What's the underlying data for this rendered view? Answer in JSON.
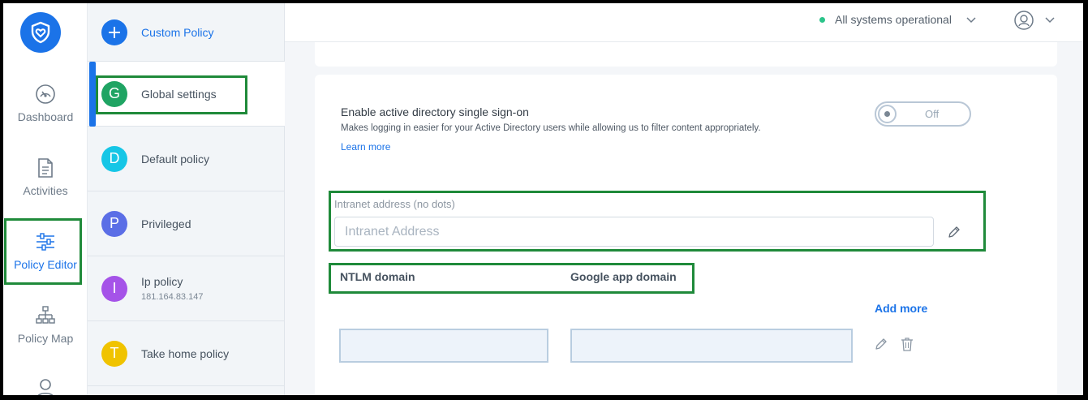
{
  "nav": {
    "items": [
      {
        "label": "Dashboard",
        "icon": "gauge-icon"
      },
      {
        "label": "Activities",
        "icon": "document-icon"
      },
      {
        "label": "Policy Editor",
        "icon": "sliders-icon"
      },
      {
        "label": "Policy Map",
        "icon": "hierarchy-icon"
      }
    ]
  },
  "policies": {
    "custom": {
      "label": "Custom Policy"
    },
    "items": [
      {
        "letter": "G",
        "name": "Global settings",
        "color": "#1fa463"
      },
      {
        "letter": "D",
        "name": "Default policy",
        "color": "#16c6e6"
      },
      {
        "letter": "P",
        "name": "Privileged",
        "color": "#5b6ee6"
      },
      {
        "letter": "I",
        "name": "Ip policy",
        "sub": "181.164.83.147",
        "color": "#a553e8"
      },
      {
        "letter": "T",
        "name": "Take home policy",
        "color": "#f0c300"
      }
    ]
  },
  "topbar": {
    "status": "All systems operational",
    "status_color": "#2bc48a"
  },
  "settings": {
    "sso_title": "Enable active directory single sign-on",
    "sso_desc": "Makes logging in easier for your Active Directory users while allowing us to filter content appropriately.",
    "learn_more": "Learn more",
    "toggle_state": "Off",
    "intranet_label": "Intranet address (no dots)",
    "intranet_placeholder": "Intranet Address",
    "ntlm_header": "NTLM domain",
    "google_header": "Google app domain",
    "add_more": "Add more"
  },
  "colors": {
    "accent": "#1b73e8",
    "highlight": "#1f8a3a"
  }
}
